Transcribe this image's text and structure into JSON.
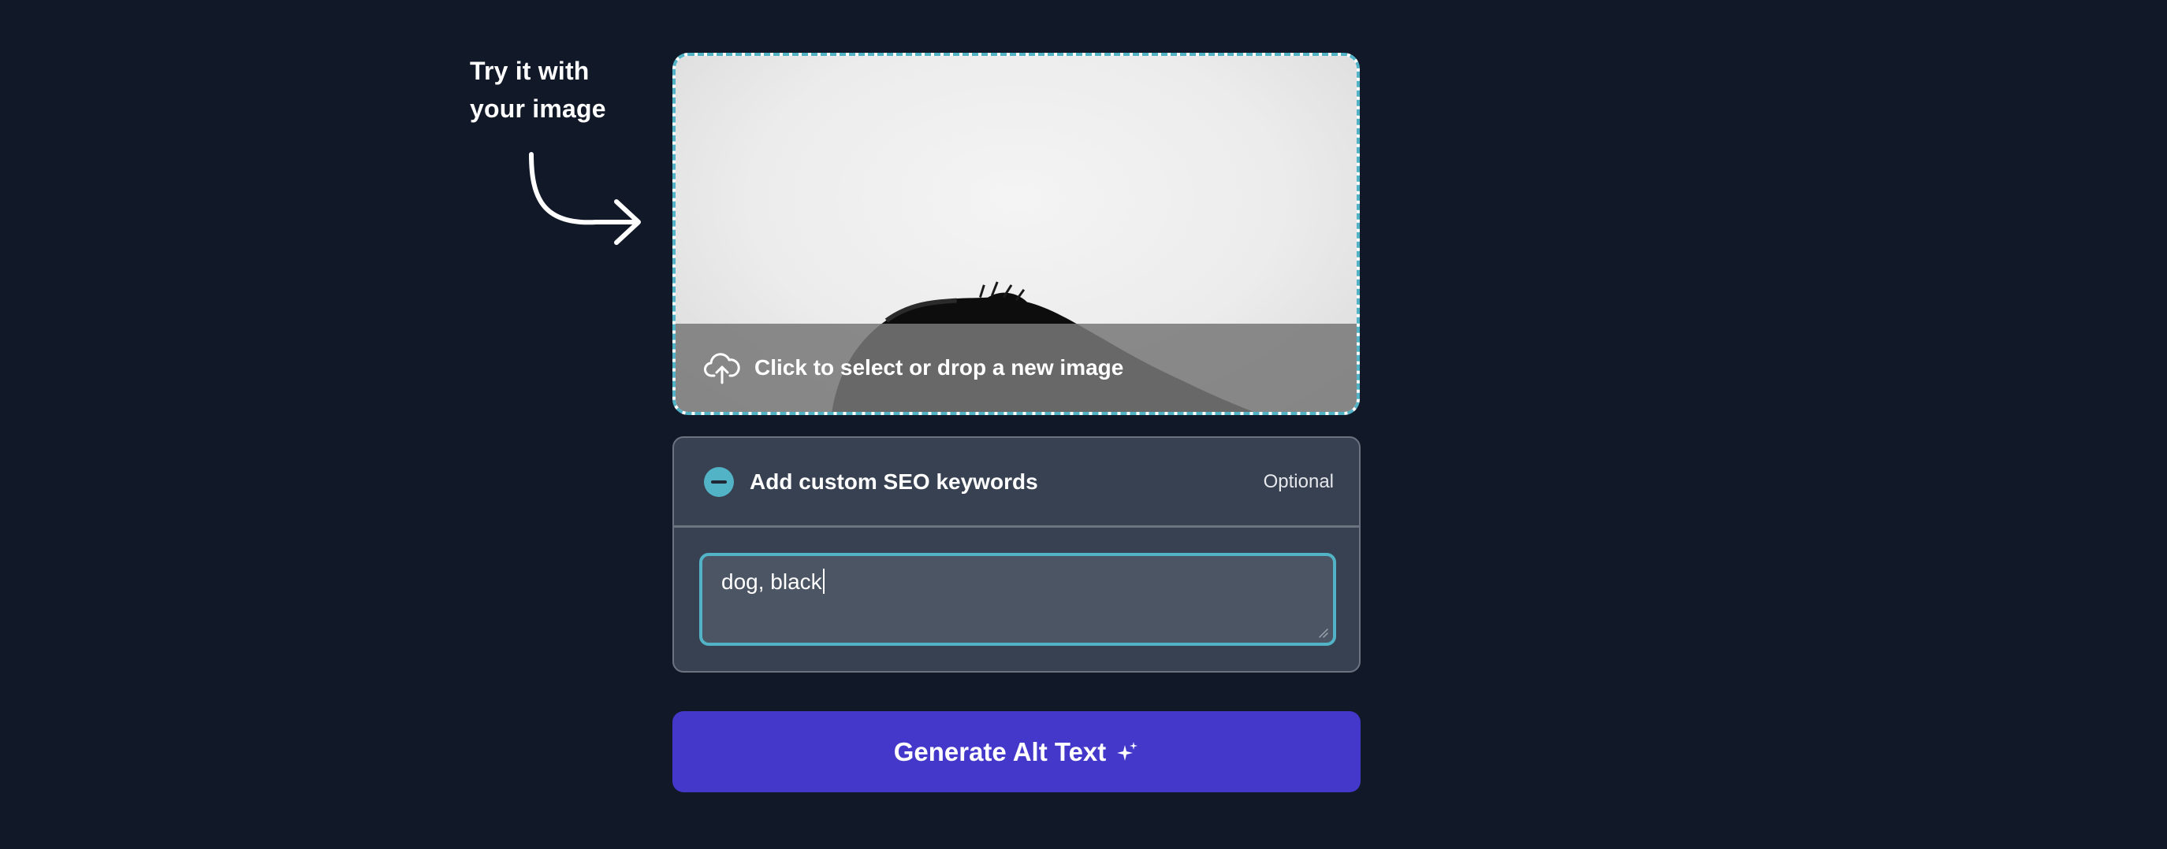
{
  "hint": {
    "line1": "Try it with",
    "line2": "your image",
    "arrow_icon": "curved-arrow-icon"
  },
  "dropzone": {
    "label": "Click to select or drop a new image",
    "icon": "cloud-upload-icon",
    "preview": "dog image preview (black dog on white background)"
  },
  "keywords": {
    "toggle_icon": "minus-circle-icon",
    "title": "Add custom SEO keywords",
    "optional_label": "Optional",
    "value": "dog, black"
  },
  "generate": {
    "label": "Generate Alt Text",
    "icon": "sparkle-icon"
  },
  "colors": {
    "background": "#111827",
    "accent": "#53b3c6",
    "panel": "#374151",
    "input": "#4b5563",
    "button": "#4338ca"
  }
}
